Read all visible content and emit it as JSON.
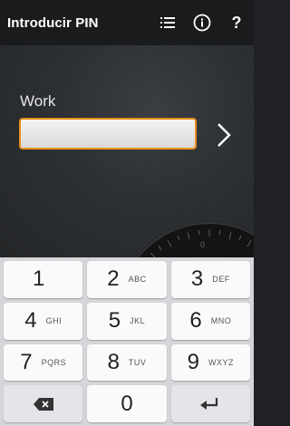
{
  "appbar": {
    "title": "Introducir PIN",
    "icons": [
      "list-icon",
      "info-icon",
      "help-icon"
    ],
    "help_glyph": "?"
  },
  "form": {
    "account_label": "Work",
    "pin_value": "",
    "accent_color": "#e8901e"
  },
  "dial": {
    "zero": "0"
  },
  "keypad": {
    "keys": [
      {
        "digit": "1",
        "letters": ""
      },
      {
        "digit": "2",
        "letters": "ABC"
      },
      {
        "digit": "3",
        "letters": "DEF"
      },
      {
        "digit": "4",
        "letters": "GHI"
      },
      {
        "digit": "5",
        "letters": "JKL"
      },
      {
        "digit": "6",
        "letters": "MNO"
      },
      {
        "digit": "7",
        "letters": "PQRS"
      },
      {
        "digit": "8",
        "letters": "TUV"
      },
      {
        "digit": "9",
        "letters": "WXYZ"
      }
    ],
    "zero": "0"
  }
}
